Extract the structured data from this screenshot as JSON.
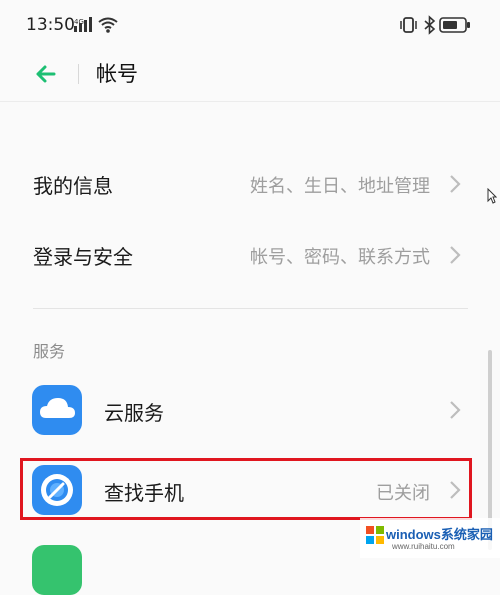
{
  "status_bar": {
    "time": "13:50",
    "network": "4G",
    "icons": [
      "signal-icon",
      "wifi-icon",
      "vibrate-icon",
      "bluetooth-icon",
      "battery-icon"
    ]
  },
  "header": {
    "title": "帐号",
    "back_icon": "back-arrow-icon",
    "back_color": "#1dbf73"
  },
  "rows": [
    {
      "label": "我的信息",
      "value": "姓名、生日、地址管理"
    },
    {
      "label": "登录与安全",
      "value": "帐号、密码、联系方式"
    }
  ],
  "services": {
    "title": "服务",
    "items": [
      {
        "label": "云服务",
        "value": "",
        "icon": "cloud-icon",
        "color": "#2f8cf0"
      },
      {
        "label": "查找手机",
        "value": "已关闭",
        "icon": "find-phone-icon",
        "color": "#2f8cf0"
      }
    ]
  },
  "watermark": {
    "text": "windows系统家园",
    "sub": "www.ruihaitu.com"
  },
  "colors": {
    "accent": "#1dbf73",
    "highlight": "#e0161f",
    "app_blue": "#2f8cf0"
  }
}
